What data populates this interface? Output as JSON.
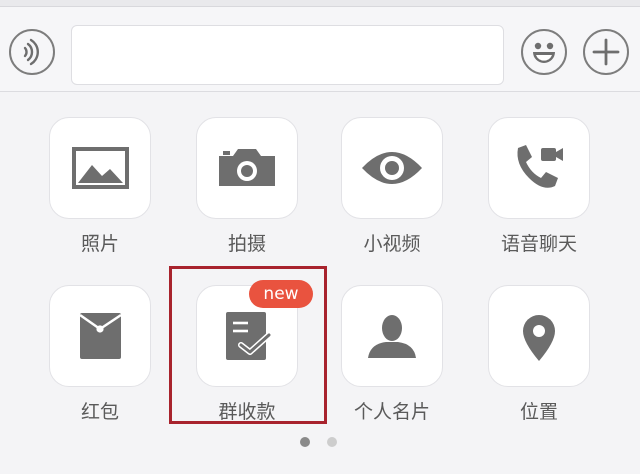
{
  "input_bar": {
    "voice_button": "voice-icon",
    "text_input": {
      "value": "",
      "placeholder": ""
    },
    "emoji_button": "smiley-face-icon",
    "plus_button": "plus-icon"
  },
  "panel": {
    "items": [
      {
        "label": "照片",
        "icon": "photo-icon"
      },
      {
        "label": "拍摄",
        "icon": "camera-icon"
      },
      {
        "label": "小视频",
        "icon": "eye-icon"
      },
      {
        "label": "语音聊天",
        "icon": "phone-video-icon"
      },
      {
        "label": "红包",
        "icon": "red-packet-icon"
      },
      {
        "label": "群收款",
        "icon": "payment-note-icon",
        "badge": "new",
        "highlighted": true
      },
      {
        "label": "个人名片",
        "icon": "person-icon"
      },
      {
        "label": "位置",
        "icon": "location-pin-icon"
      }
    ],
    "page_indicator": {
      "pages": 2,
      "current": 1
    }
  },
  "colors": {
    "icon": "#6e6e6e",
    "badge": "#e9533f",
    "highlight": "#a8232d",
    "label": "#5a5a5a"
  }
}
